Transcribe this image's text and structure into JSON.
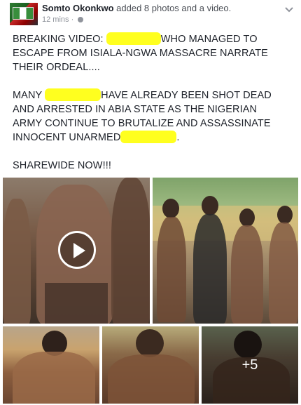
{
  "post": {
    "author": "Somto Okonkwo",
    "action": " added 8 photos and a video.",
    "time": "12 mins",
    "time_separator": " · ",
    "icons": {
      "privacy": "globe-icon",
      "menu": "chevron-down-icon",
      "video": "play-icon"
    },
    "text": {
      "line1_start": "BREAKING VIDEO: ",
      "line1_end": "WHO MANAGED TO",
      "line2": "ESCAPE FROM ISIALA-NGWA MASSACRE NARRATE",
      "line3": "THEIR ORDEAL....",
      "p2_line1_start": "MANY ",
      "p2_line1_end": "HAVE ALREADY BEEN SHOT DEAD",
      "p2_line2": "AND ARRESTED IN ABIA STATE AS THE NIGERIAN",
      "p2_line3": "ARMY CONTINUE TO BRUTALIZE AND ASSASSINATE",
      "p2_line4_start": "INNOCENT UNARMED",
      "p2_line4_end": ".",
      "p3": "SHAREWIDE NOW!!!"
    },
    "more_photos": "+5",
    "colors": {
      "highlight": "#ffff1f",
      "text": "#1d2129",
      "meta": "#90949c"
    }
  }
}
